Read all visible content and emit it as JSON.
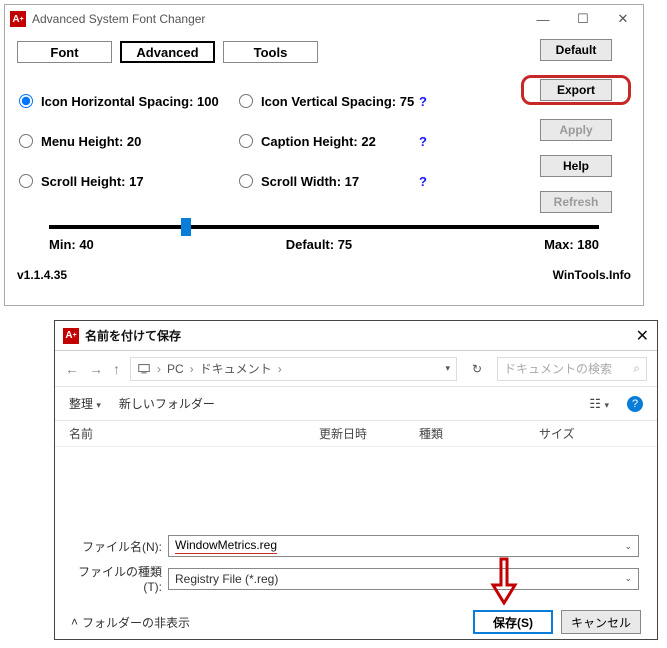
{
  "main": {
    "title": "Advanced System Font Changer",
    "tabs": {
      "font": "Font",
      "advanced": "Advanced",
      "tools": "Tools"
    },
    "options": {
      "iconH": "Icon Horizontal Spacing: 100",
      "iconV": "Icon Vertical Spacing: 75",
      "menuH": "Menu Height: 20",
      "captionH": "Caption Height: 22",
      "scrollH": "Scroll Height: 17",
      "scrollW": "Scroll Width: 17",
      "help": "?"
    },
    "buttons": {
      "default": "Default",
      "export": "Export",
      "apply": "Apply",
      "help": "Help",
      "refresh": "Refresh"
    },
    "slider": {
      "min": "Min: 40",
      "default": "Default: 75",
      "max": "Max: 180"
    },
    "version": "v1.1.4.35",
    "site": "WinTools.Info"
  },
  "dlg": {
    "title": "名前を付けて保存",
    "breadcrumb": {
      "pc": "PC",
      "docs": "ドキュメント"
    },
    "searchPlaceholder": "ドキュメントの検索",
    "toolbar": {
      "organize": "整理",
      "newfolder": "新しいフォルダー"
    },
    "cols": {
      "name": "名前",
      "date": "更新日時",
      "type": "種類",
      "size": "サイズ"
    },
    "form": {
      "nameLabel": "ファイル名(N):",
      "nameValue": "WindowMetrics.reg",
      "typeLabel": "ファイルの種類(T):",
      "typeValue": "Registry File (*.reg)"
    },
    "hideFolders": "フォルダーの非表示",
    "save": "保存(S)",
    "cancel": "キャンセル"
  }
}
